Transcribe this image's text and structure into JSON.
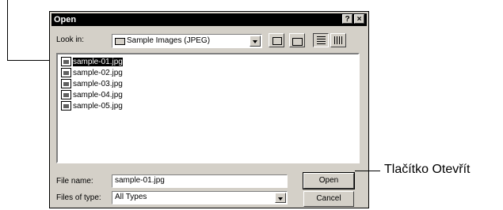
{
  "dialog": {
    "title": "Open",
    "help_glyph": "?",
    "close_glyph": "×"
  },
  "look_in": {
    "label": "Look in:",
    "value": "Sample Images (JPEG)",
    "icon": "folder-icon"
  },
  "toolbar": {
    "icons": [
      "up-one-level-icon",
      "create-new-folder-icon",
      "list-view-icon",
      "details-view-icon"
    ]
  },
  "files": [
    {
      "name": "sample-01.jpg",
      "selected": true
    },
    {
      "name": "sample-02.jpg",
      "selected": false
    },
    {
      "name": "sample-03.jpg",
      "selected": false
    },
    {
      "name": "sample-04.jpg",
      "selected": false
    },
    {
      "name": "sample-05.jpg",
      "selected": false
    }
  ],
  "file_name": {
    "label": "File name:",
    "value": "sample-01.jpg"
  },
  "file_type": {
    "label": "Files of type:",
    "value": "All Types"
  },
  "buttons": {
    "open": "Open",
    "cancel": "Cancel"
  },
  "callout": {
    "text": "Tlačítko Otevřít"
  }
}
